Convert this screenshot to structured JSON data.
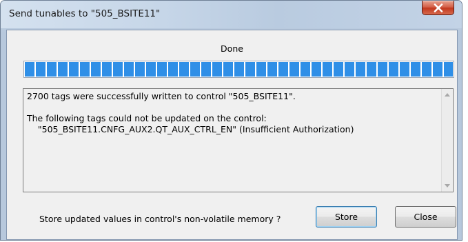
{
  "window": {
    "title": "Send tunables to \"505_BSITE11\""
  },
  "progress": {
    "status": "Done",
    "fraction": 1.0
  },
  "messages": {
    "line1": "2700 tags were successfully written to control \"505_BSITE11\".",
    "line2": "The following tags could not be updated on the control:",
    "line3": "    \"505_BSITE11.CNFG_AUX2.QT_AUX_CTRL_EN\" (Insufficient Authorization)"
  },
  "footer": {
    "question": "Store updated values in control's non-volatile memory ?",
    "store_label": "Store",
    "close_label": "Close"
  },
  "icons": {
    "close": "close-icon",
    "scroll_up": "scroll-up-arrow-icon",
    "scroll_down": "scroll-down-arrow-icon"
  },
  "colors": {
    "progress_fill": "#2f8fe7",
    "close_button": "#c2391f"
  }
}
